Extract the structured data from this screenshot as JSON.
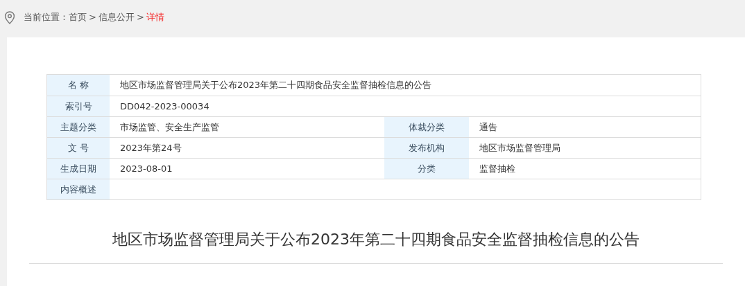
{
  "breadcrumb": {
    "prefix": "当前位置：",
    "separator": ">",
    "items": [
      {
        "label": "首页",
        "selected": false
      },
      {
        "label": "信息公开",
        "selected": false
      },
      {
        "label": "详情",
        "selected": true
      }
    ]
  },
  "info_table": {
    "rows": [
      [
        {
          "label": "名 称",
          "value": "地区市场监督管理局关于公布2023年第二十四期食品安全监督抽检信息的公告"
        }
      ],
      [
        {
          "label": "索引号",
          "value": "DD042-2023-00034"
        }
      ],
      [
        {
          "label": "主题分类",
          "value": "市场监管、安全生产监管"
        },
        {
          "label": "体裁分类",
          "value": "通告"
        }
      ],
      [
        {
          "label": "文 号",
          "value": "2023年第24号"
        },
        {
          "label": "发布机构",
          "value": "地区市场监督管理局"
        }
      ],
      [
        {
          "label": "生成日期",
          "value": "2023-08-01"
        },
        {
          "label": "分类",
          "value": "监督抽检"
        }
      ],
      [
        {
          "label": "内容概述"
        }
      ]
    ]
  },
  "article": {
    "title": "地区市场监督管理局关于公布2023年第二十四期食品安全监督抽检信息的公告"
  }
}
